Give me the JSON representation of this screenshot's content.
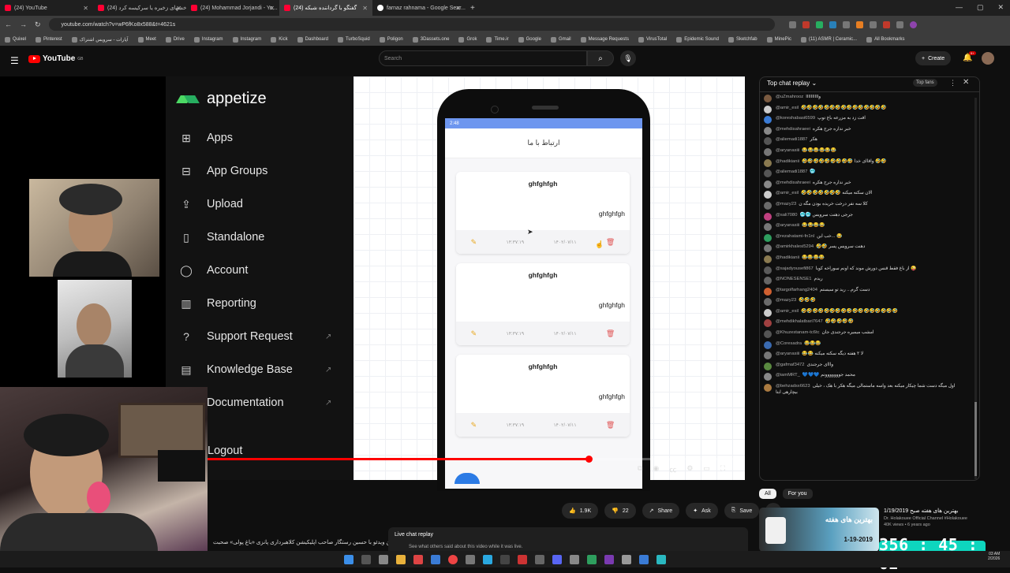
{
  "browser": {
    "tabs": [
      {
        "label": "(24) YouTube",
        "active": false
      },
      {
        "label": "(24) خشهای زخیره یا سرکیسه کرد...",
        "active": false
      },
      {
        "label": "(24) Mohammad Jorjandi - Yo...",
        "active": false
      },
      {
        "label": "(24) گفتگو با گرداننده شبکه",
        "active": true
      },
      {
        "label": "farnaz rahnama - Google Sear...",
        "active": false
      }
    ],
    "url": "youtube.com/watch?v=wP6fKo8x588&t=4621s",
    "bookmarks": [
      "Quixel",
      "Pinterest",
      "آپارات - سرویس اشتراک",
      "Meet",
      "Drive",
      "Instagram",
      "Instagram",
      "Kick",
      "Dashboard",
      "TurboSquid",
      "Poligon",
      "3Dassets.one",
      "Grok",
      "Time.ir",
      "Google",
      "Gmail",
      "Message Requests",
      "VirusTotal",
      "Epidemic Sound",
      "Sketchfab",
      "MinePic",
      "(11) ASMR | Ceramic...",
      "All Bookmarks"
    ]
  },
  "youtube": {
    "logo": "YouTube",
    "region": "GB",
    "search_placeholder": "Search",
    "create_label": "Create",
    "bell_badge": "9+"
  },
  "appetize": {
    "brand": "appetize",
    "nav": [
      {
        "label": "Apps",
        "icon": "grid-icon"
      },
      {
        "label": "App Groups",
        "icon": "app-groups-icon"
      },
      {
        "label": "Upload",
        "icon": "upload-icon"
      },
      {
        "label": "Standalone",
        "icon": "phone-icon"
      },
      {
        "label": "Account",
        "icon": "account-icon"
      },
      {
        "label": "Reporting",
        "icon": "bar-chart-icon"
      },
      {
        "label": "Support Request",
        "icon": "help-icon"
      },
      {
        "label": "Knowledge Base",
        "icon": "book-icon"
      },
      {
        "label": "Documentation",
        "icon": "doc-icon"
      },
      {
        "label": "Logout",
        "icon": "logout-icon"
      }
    ]
  },
  "phone_app": {
    "status_time": "2:48",
    "title": "ارتباط با ما",
    "cards": [
      {
        "title": "ghfghfgh",
        "subtitle": "ghfghfgh",
        "time": "۱۴:۳۷:۱۹",
        "date": "۱۴۰۲/۰۷/۱۱"
      },
      {
        "title": "ghfghfgh",
        "subtitle": "ghfghfgh",
        "time": "۱۴:۳۷:۱۹",
        "date": "۱۴۰۲/۰۷/۱۱"
      },
      {
        "title": "ghfghfgh",
        "subtitle": "ghfghfgh",
        "time": "۱۴:۳۷:۱۹",
        "date": "۱۴۰۲/۰۷/۱۱"
      }
    ]
  },
  "player": {
    "progress": 0.71
  },
  "below_video": {
    "title": "در این ویدئو با حسین رستگار صاحب اپلیکیشن کلاهبرداری پانزی «باغ پولی» صحبت",
    "likes": "1.9K",
    "dislikes": "22",
    "share": "Share",
    "ask": "Ask",
    "save": "Save",
    "live_replay_title": "Live chat replay",
    "live_replay_sub": "See what others said about this video while it was live."
  },
  "chat": {
    "title": "Top chat replay",
    "top_fans": "Top fans",
    "messages": [
      {
        "user": "@uZmahrooz",
        "text": "واااااااااا",
        "color": "#7a5a40"
      },
      {
        "user": "@amir_esil",
        "text": "🤣🤣🤣🤣🤣🤣🤣🤣🤣🤣🤣🤣🤣🤣🤣",
        "color": "#cccccc"
      },
      {
        "user": "@koreshabasi6599",
        "text": "افت زد به مزرعه باغ توپ",
        "color": "#3a7bd5"
      },
      {
        "user": "@mehdisahraeei",
        "text": "خبر نداره جرج هکره",
        "color": "#888888"
      },
      {
        "user": "@aliemadi1887",
        "text": "هکر",
        "color": "#555555"
      },
      {
        "user": "@aryanasiii",
        "text": "😂😂😂😂😂😂",
        "color": "#777777"
      },
      {
        "user": "@hadikianii",
        "text": "🤣🤣🤣🤣🤣🤣🤣🤣🤣 واقاای خدا 🤣🤣",
        "color": "#8a7a50"
      },
      {
        "user": "@aliemadi1887",
        "text": "🥶",
        "color": "#555555"
      },
      {
        "user": "@mehdisahraeei",
        "text": "خبر نداره جرج هکره",
        "color": "#888888"
      },
      {
        "user": "@amir_esil",
        "text": "🤣🤣🤣🤣🤣🤣🤣 الان سکته میکنه",
        "color": "#cccccc"
      },
      {
        "user": "@mazy23",
        "text": "کلا سه نفر درخت خریده بودن مگه ن",
        "color": "#6a6a6a"
      },
      {
        "user": "@sali7080",
        "text": "🥶🥶 جرجی دهنت سرویس",
        "color": "#c04080"
      },
      {
        "user": "@aryanasiii",
        "text": "😂😂😂😂",
        "color": "#777777"
      },
      {
        "user": "@rezahatami-fn1nl",
        "text": "خب این... 😂",
        "color": "#2e9e5e"
      },
      {
        "user": "@amirkhalesi5294",
        "text": "🤣🤣 دهنت سرویس پسر",
        "color": "#777777"
      },
      {
        "user": "@hadikianii",
        "text": "😂😂😂😂",
        "color": "#8a7a50"
      },
      {
        "user": "@sajadyousefi867",
        "text": "از باغ فقط قنس دورش موند که اونم سوراخه کوبا 😜",
        "color": "#5a5a5a"
      },
      {
        "user": "@NONESENSE1",
        "text": "ریدم",
        "color": "#666666"
      },
      {
        "user": "@targolfarhang2404",
        "text": "دست گرم... رید تو سیستم",
        "color": "#d06030"
      },
      {
        "user": "@mazy23",
        "text": "🤣🤣🤣",
        "color": "#6a6a6a"
      },
      {
        "user": "@amir_esil",
        "text": "🤣🤣🤣🤣🤣🤣🤣🤣🤣🤣🤣🤣🤣🤣🤣🤣🤣",
        "color": "#cccccc"
      },
      {
        "user": "@mehdikhalatbari7647",
        "text": "🤣🤣🤣🤣🤣",
        "color": "#a04040"
      },
      {
        "user": "@Khuzestanam-tc6tc",
        "text": "امشب میمیره جرجندی جان",
        "color": "#555555"
      },
      {
        "user": "@Coresadra",
        "text": "😂😂😂",
        "color": "#3a6ab0"
      },
      {
        "user": "@aryanasiii",
        "text": "😂😂 لا ۲ هفته دیگه سکته میکنه",
        "color": "#777777"
      },
      {
        "user": "@gafmaf3472",
        "text": "وااای جرجندی",
        "color": "#5a8a40"
      },
      {
        "user": "@iamMRT_",
        "text": "💙💙💙 محمد جووووووونم",
        "color": "#888888"
      },
      {
        "user": "@behzadsx6623",
        "text": "اول میگه دست شما چیکار میکنه بعد واسه ماستمالی میگه هکر با هک ، خیلی بیچارهی ابتا",
        "color": "#aa7a40"
      }
    ]
  },
  "chips": [
    "All",
    "For you"
  ],
  "recommendation": {
    "title": "بهترین های هفته صبح 1/19/2019",
    "channel": "Dr. Holakouee Official Channel #Holakouee",
    "meta": "40K views • 6 years ago",
    "thumb_text": "بهترین های هفته",
    "thumb_date": "1-19-2019"
  },
  "timer": "356 : 45 : 02",
  "tray": {
    "time": "03 AM",
    "date": "2/2026"
  },
  "colors": {
    "youtube_red": "#ff0000",
    "timer_bg": "#0ed6be",
    "appetize_green": "#4cd964",
    "phone_status": "#6d96ef"
  }
}
